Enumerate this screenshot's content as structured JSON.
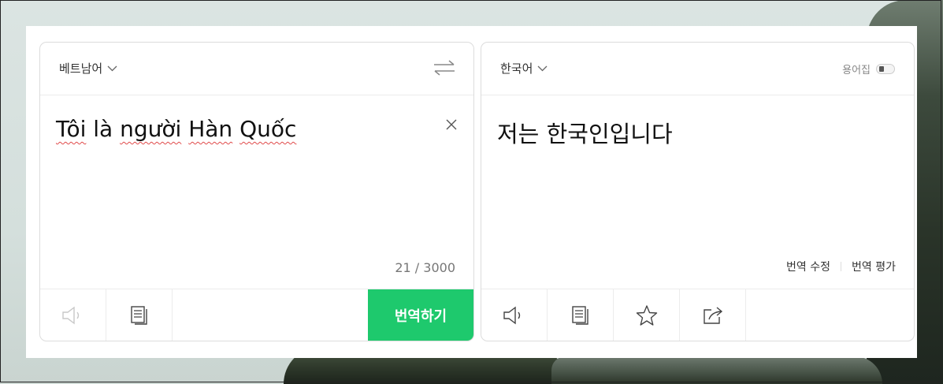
{
  "source": {
    "language": "베트남어",
    "text_words": [
      "Tôi",
      " là ",
      "người",
      " ",
      "Hàn",
      " ",
      "Quốc"
    ],
    "counter": "21 / 3000",
    "translate_label": "번역하기"
  },
  "target": {
    "language": "한국어",
    "glossary_label": "용어집",
    "text": "저는 한국인입니다",
    "edit_label": "번역 수정",
    "rate_label": "번역 평가"
  },
  "colors": {
    "accent": "#1ec96d"
  }
}
